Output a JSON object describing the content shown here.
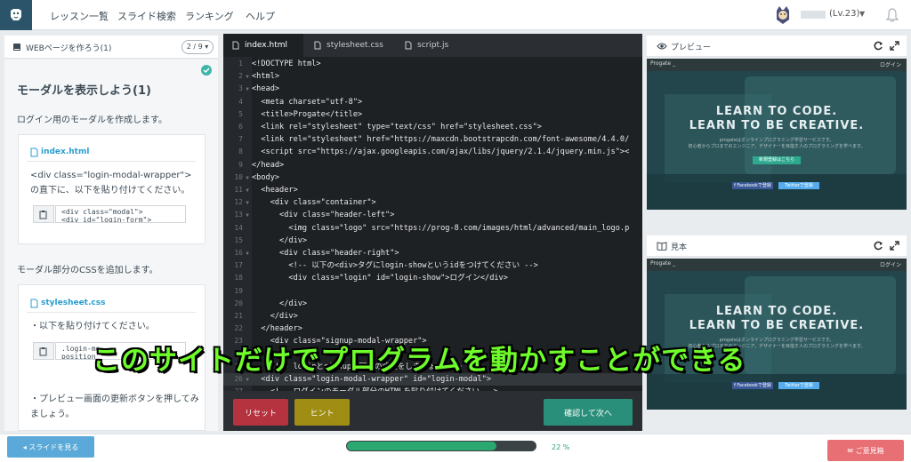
{
  "nav": {
    "links": [
      "レッスン一覧",
      "スライド検索",
      "ランキング",
      "ヘルプ"
    ],
    "user_level": "(Lv.23)"
  },
  "left": {
    "header_title": "WEBページを作ろう(1)",
    "page_indicator": "2 / 9 ▾",
    "lesson_title": "モーダルを表示しよう(1)",
    "lesson_desc": "ログイン用のモーダルを作成します。",
    "card1": {
      "file": "index.html",
      "text_line1": "<div class=\"login-modal-wrapper\">",
      "text_line2": "の直下に、以下を貼り付けてください。",
      "snippet_line1": "<div class=\"modal\">",
      "snippet_line2": "  <div id=\"login-form\">"
    },
    "section2_head": "モーダル部分のCSSを追加します。",
    "card2": {
      "file": "stylesheet.css",
      "text_line1": "・以下を貼り付けてください。",
      "snippet_line1": ".login-mo",
      "snippet_line2": "  position",
      "text_line2": "・プレビュー画面の更新ボタンを押してみ",
      "text_line3": "ましょう。"
    }
  },
  "editor": {
    "tabs": [
      "index.html",
      "stylesheet.css",
      "script.js"
    ],
    "lines": [
      {
        "n": "1",
        "t": "<!DOCTYPE html>"
      },
      {
        "n": "2",
        "t": "<html>"
      },
      {
        "n": "3",
        "t": "<head>"
      },
      {
        "n": "4",
        "t": "  <meta charset=\"utf-8\">"
      },
      {
        "n": "5",
        "t": "  <title>Progate</title>"
      },
      {
        "n": "6",
        "t": "  <link rel=\"stylesheet\" type=\"text/css\" href=\"stylesheet.css\">"
      },
      {
        "n": "7",
        "t": "  <link rel=\"stylesheet\" href=\"https://maxcdn.bootstrapcdn.com/font-awesome/4.4.0/"
      },
      {
        "n": "8",
        "t": "  <script src=\"https://ajax.googleapis.com/ajax/libs/jquery/2.1.4/jquery.min.js\"><"
      },
      {
        "n": "9",
        "t": "</head>"
      },
      {
        "n": "10",
        "t": "<body>"
      },
      {
        "n": "11",
        "t": "  <header>"
      },
      {
        "n": "12",
        "t": "    <div class=\"container\">"
      },
      {
        "n": "13",
        "t": "      <div class=\"header-left\">"
      },
      {
        "n": "14",
        "t": "        <img class=\"logo\" src=\"https://prog-8.com/images/html/advanced/main_logo.p"
      },
      {
        "n": "15",
        "t": "      </div>"
      },
      {
        "n": "16",
        "t": "      <div class=\"header-right\">"
      },
      {
        "n": "17",
        "t": "        <!-- 以下の<div>タグにlogin-showというidをつけてください -->"
      },
      {
        "n": "18",
        "t": "        <div class=\"login\" id=\"login-show\">ログイン</div>"
      },
      {
        "n": "19",
        "t": ""
      },
      {
        "n": "20",
        "t": "      </div>"
      },
      {
        "n": "21",
        "t": "    </div>"
      },
      {
        "n": "22",
        "t": "  </header>"
      },
      {
        "n": "23",
        "t": "    <div class=\"signup-modal-wrapper\">"
      },
      {
        "n": "24",
        "t": ""
      },
      {
        "n": "25",
        "t": "    <!-- loginとsignupで同様の設定をしましょう -->"
      },
      {
        "n": "26",
        "t": "  <div class=\"login-modal-wrapper\" id=\"login-modal\">"
      },
      {
        "n": "27",
        "t": "    <!-- ログインのモーダル部分のHTMLを貼り付けてください -->"
      }
    ],
    "reset_label": "リセット",
    "hint_label": "ヒント",
    "next_label": "確認して次へ"
  },
  "preview": {
    "title": "プレビュー",
    "brand": "Progate _",
    "login": "ログイン",
    "head1": "LEARN TO CODE.",
    "head2": "LEARN TO BE CREATIVE.",
    "sub1": "progateはオンラインプログラミング学習サービスです。",
    "sub2": "初心者からプロまでのエンジニア、デザイナーを目指す人のプログラミングを学べます。",
    "cta": "新規登録はこちら",
    "fb": "f Facebookで登録",
    "tw": "Twitterで登録"
  },
  "sample": {
    "title": "見本"
  },
  "caption": "このサイトだけでプログラムを動かすことができる",
  "bottom": {
    "slide_label": "◂ スライドを見る",
    "progress_text": "22 %",
    "progress_value": 22,
    "feedback_label": "✉ ご意見箱"
  },
  "colors": {
    "accent": "#2aa86f",
    "reset": "#b5323f",
    "hint": "#a08e14",
    "next": "#2a8f7a",
    "caption": "#6efc2a"
  }
}
